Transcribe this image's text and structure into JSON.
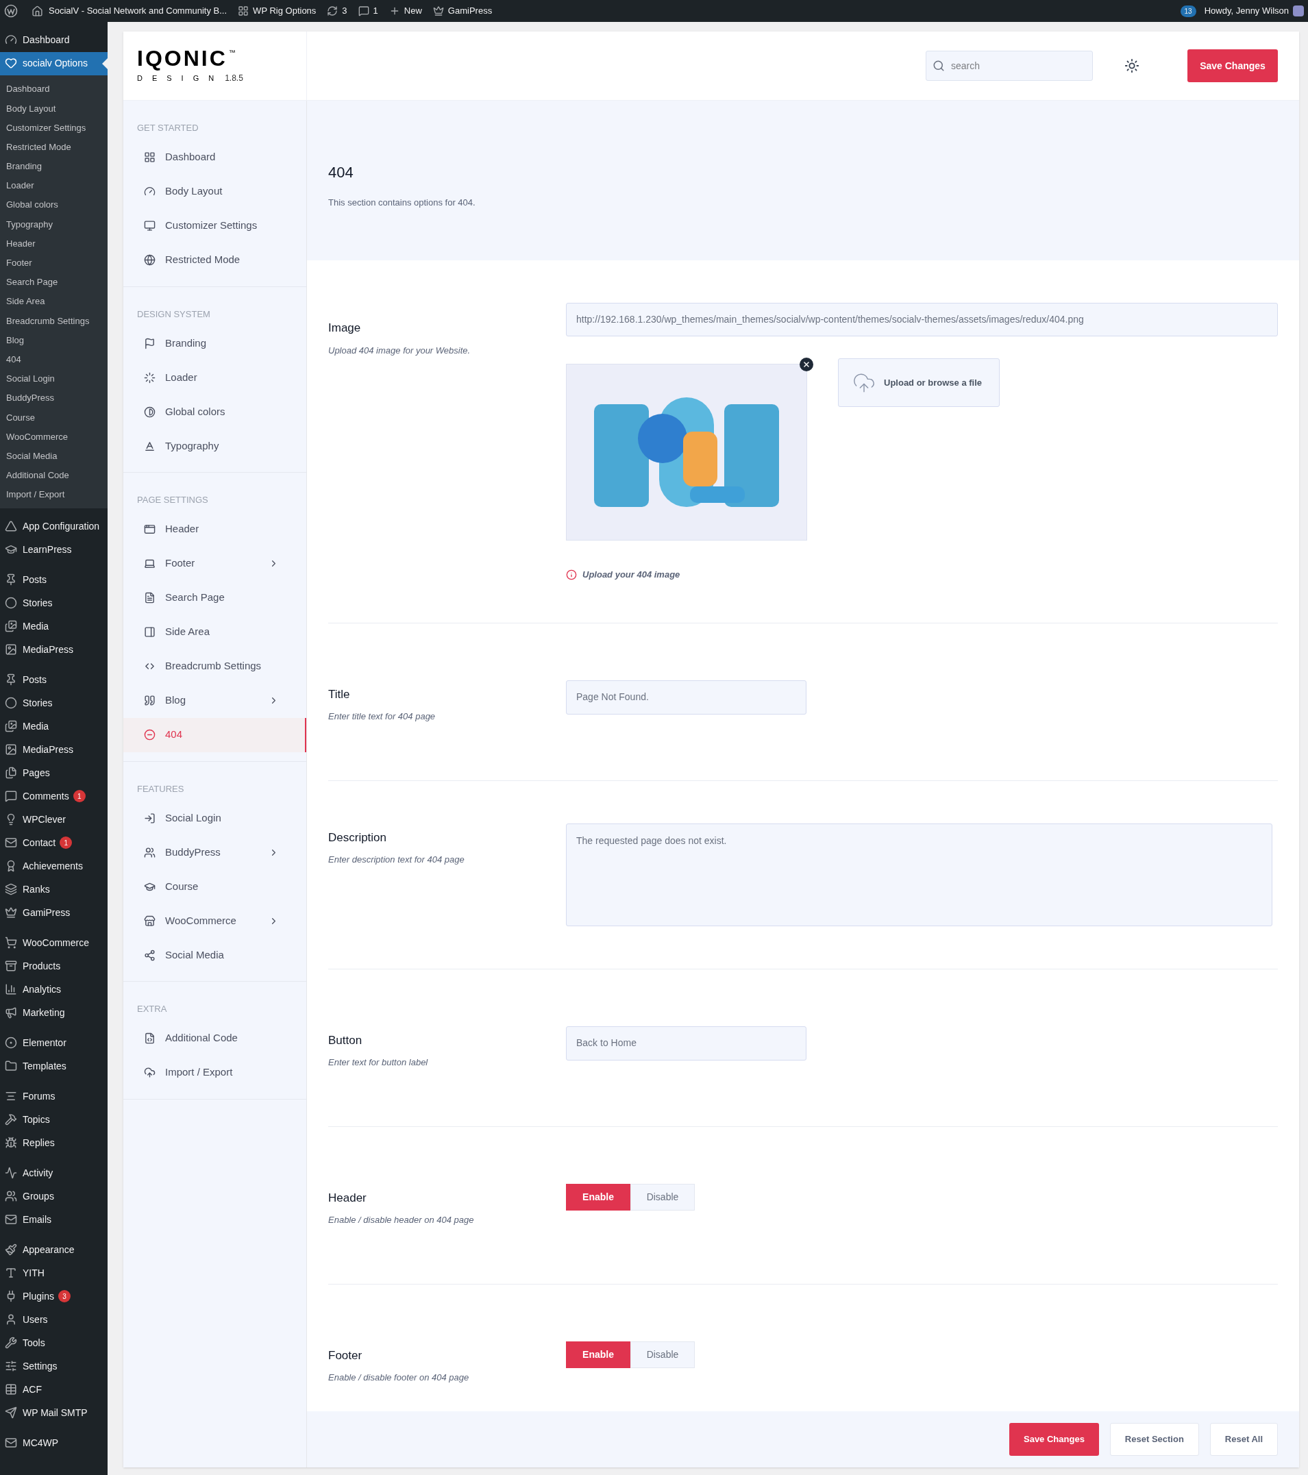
{
  "admin_bar": {
    "site_title": "SocialV - Social Network and Community B...",
    "items": [
      {
        "label": "WP Rig Options"
      },
      {
        "label": "3"
      },
      {
        "label": "1"
      },
      {
        "label": "New"
      },
      {
        "label": "GamiPress"
      }
    ],
    "notifications": "13",
    "greeting": "Howdy, Jenny Wilson"
  },
  "admin_menu": {
    "groups": [
      {
        "items": [
          {
            "label": "Dashboard",
            "selected": false
          },
          {
            "label": "socialv Options",
            "selected": true,
            "submenu": [
              "Dashboard",
              "Body Layout",
              "Customizer Settings",
              "Restricted Mode",
              "Branding",
              "Loader",
              "Global colors",
              "Typography",
              "Header",
              "Footer",
              "Search Page",
              "Side Area",
              "Breadcrumb Settings",
              "Blog",
              "404",
              "Social Login",
              "BuddyPress",
              "Course",
              "WooCommerce",
              "Social Media",
              "Additional Code",
              "Import / Export"
            ]
          }
        ]
      },
      {
        "items": [
          {
            "label": "App Configuration",
            "selected": false
          },
          {
            "label": "LearnPress",
            "selected": false
          }
        ]
      },
      {
        "items": [
          {
            "label": "Posts",
            "selected": false
          },
          {
            "label": "Stories",
            "selected": false
          },
          {
            "label": "Media",
            "selected": false
          },
          {
            "label": "MediaPress",
            "selected": false
          }
        ]
      },
      {
        "items": [
          {
            "label": "Posts",
            "selected": false
          },
          {
            "label": "Stories",
            "selected": false
          },
          {
            "label": "Media",
            "selected": false
          },
          {
            "label": "MediaPress",
            "selected": false
          },
          {
            "label": "Pages",
            "selected": false
          },
          {
            "label": "Comments",
            "selected": false,
            "badge": "1"
          },
          {
            "label": "WPClever",
            "selected": false
          },
          {
            "label": "Contact",
            "selected": false,
            "badge": "1"
          },
          {
            "label": "Achievements",
            "selected": false
          },
          {
            "label": "Ranks",
            "selected": false
          },
          {
            "label": "GamiPress",
            "selected": false
          }
        ]
      },
      {
        "items": [
          {
            "label": "WooCommerce",
            "selected": false
          },
          {
            "label": "Products",
            "selected": false
          },
          {
            "label": "Analytics",
            "selected": false
          },
          {
            "label": "Marketing",
            "selected": false
          }
        ]
      },
      {
        "items": [
          {
            "label": "Elementor",
            "selected": false
          },
          {
            "label": "Templates",
            "selected": false
          }
        ]
      },
      {
        "items": [
          {
            "label": "Forums",
            "selected": false
          },
          {
            "label": "Topics",
            "selected": false
          },
          {
            "label": "Replies",
            "selected": false
          }
        ]
      },
      {
        "items": [
          {
            "label": "Activity",
            "selected": false
          },
          {
            "label": "Groups",
            "selected": false
          },
          {
            "label": "Emails",
            "selected": false
          }
        ]
      },
      {
        "items": [
          {
            "label": "Appearance",
            "selected": false
          },
          {
            "label": "YITH",
            "selected": false
          },
          {
            "label": "Plugins",
            "selected": false,
            "badge": "3"
          },
          {
            "label": "Users",
            "selected": false
          },
          {
            "label": "Tools",
            "selected": false
          },
          {
            "label": "Settings",
            "selected": false
          },
          {
            "label": "ACF",
            "selected": false
          },
          {
            "label": "WP Mail SMTP",
            "selected": false
          }
        ]
      },
      {
        "items": [
          {
            "label": "MC4WP",
            "selected": false
          }
        ]
      }
    ]
  },
  "options_header": {
    "logo": "IQONIC",
    "logo_mark": "™",
    "logo_sub": "DESIGN",
    "version": "1.8.5",
    "search": {
      "placeholder": "search"
    },
    "save_button": "Save Changes"
  },
  "options_nav": [
    {
      "heading": "GET STARTED",
      "items": [
        {
          "label": "Dashboard",
          "selected": false,
          "has_children": false
        },
        {
          "label": "Body Layout",
          "selected": false,
          "has_children": false
        },
        {
          "label": "Customizer Settings",
          "selected": false,
          "has_children": false
        },
        {
          "label": "Restricted Mode",
          "selected": false,
          "has_children": false
        }
      ]
    },
    {
      "heading": "DESIGN SYSTEM",
      "items": [
        {
          "label": "Branding",
          "selected": false,
          "has_children": false
        },
        {
          "label": "Loader",
          "selected": false,
          "has_children": false
        },
        {
          "label": "Global colors",
          "selected": false,
          "has_children": false
        },
        {
          "label": "Typography",
          "selected": false,
          "has_children": false
        }
      ]
    },
    {
      "heading": "PAGE SETTINGS",
      "items": [
        {
          "label": "Header",
          "selected": false,
          "has_children": false
        },
        {
          "label": "Footer",
          "selected": false,
          "has_children": true
        },
        {
          "label": "Search Page",
          "selected": false,
          "has_children": false
        },
        {
          "label": "Side Area",
          "selected": false,
          "has_children": false
        },
        {
          "label": "Breadcrumb Settings",
          "selected": false,
          "has_children": false
        },
        {
          "label": "Blog",
          "selected": false,
          "has_children": true
        },
        {
          "label": "404",
          "selected": true,
          "has_children": false
        }
      ]
    },
    {
      "heading": "FEATURES",
      "items": [
        {
          "label": "Social Login",
          "selected": false,
          "has_children": false
        },
        {
          "label": "BuddyPress",
          "selected": false,
          "has_children": true
        },
        {
          "label": "Course",
          "selected": false,
          "has_children": false
        },
        {
          "label": "WooCommerce",
          "selected": false,
          "has_children": true
        },
        {
          "label": "Social Media",
          "selected": false,
          "has_children": false
        }
      ]
    },
    {
      "heading": "EXTRA",
      "items": [
        {
          "label": "Additional Code",
          "selected": false,
          "has_children": false
        },
        {
          "label": "Import / Export",
          "selected": false,
          "has_children": false
        }
      ]
    }
  ],
  "section": {
    "title": "404",
    "description": "This section contains options for 404."
  },
  "fields": [
    {
      "kind": "media",
      "label": "Image",
      "hint": "Upload 404 image for your Website.",
      "value": "http://192.168.1.230/wp_themes/main_themes/socialv/wp-content/themes/socialv-themes/assets/images/redux/404.png",
      "upload_button": "Upload or browse a file",
      "warning": "Upload your 404 image"
    },
    {
      "kind": "text",
      "label": "Title",
      "hint": "Enter title text for 404 page",
      "value": "Page Not Found."
    },
    {
      "kind": "textarea",
      "label": "Description",
      "hint": "Enter description text for 404 page",
      "value": "The requested page does not exist."
    },
    {
      "kind": "text",
      "label": "Button",
      "hint": "Enter text for button label",
      "value": "Back to Home"
    },
    {
      "kind": "switch",
      "label": "Header",
      "hint": "Enable / disable header on 404 page",
      "options": [
        {
          "label": "Enable",
          "selected": true
        },
        {
          "label": "Disable",
          "selected": false
        }
      ]
    },
    {
      "kind": "switch",
      "label": "Footer",
      "hint": "Enable / disable footer on 404 page",
      "options": [
        {
          "label": "Enable",
          "selected": true
        },
        {
          "label": "Disable",
          "selected": false
        }
      ]
    }
  ],
  "footer_buttons": [
    {
      "label": "Save Changes",
      "kind": "primary"
    },
    {
      "label": "Reset Section",
      "kind": "secondary"
    },
    {
      "label": "Reset All",
      "kind": "secondary"
    }
  ]
}
